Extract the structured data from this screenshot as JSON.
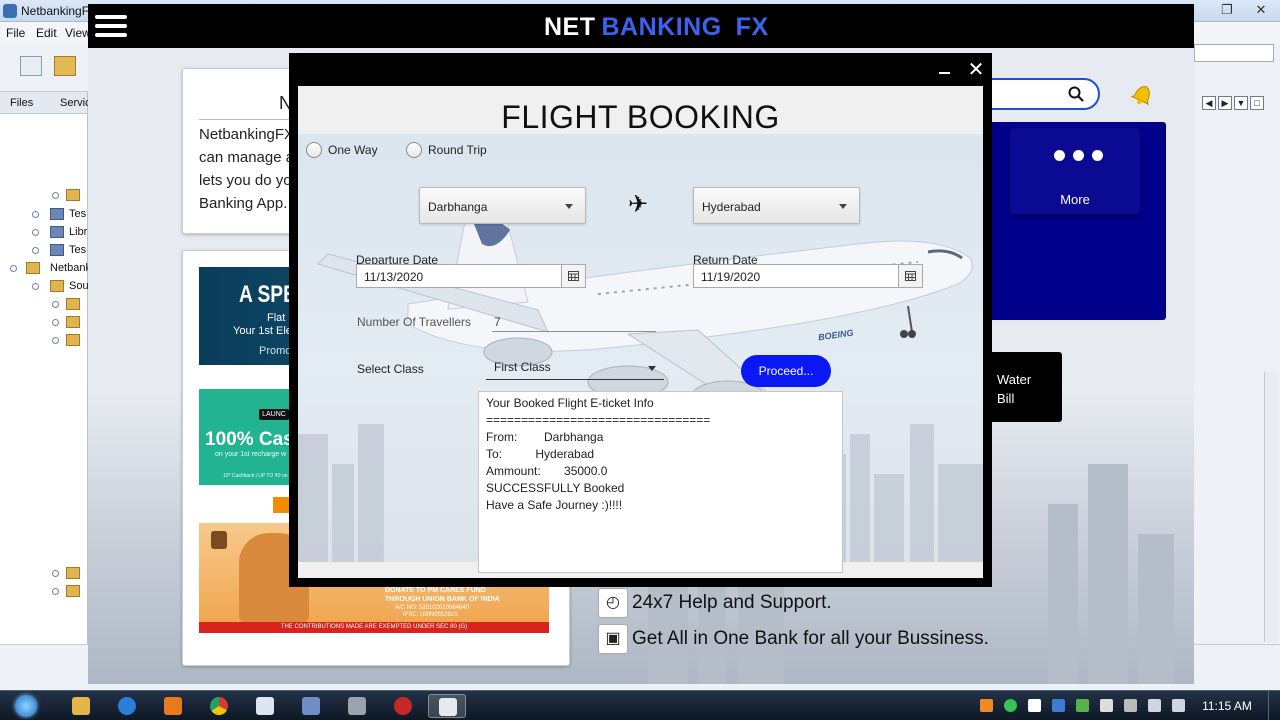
{
  "ide": {
    "window_title": "NetbankingF",
    "menu": [
      "File",
      "Edit",
      "View"
    ],
    "panel_tabs": [
      "Files",
      "Servic"
    ],
    "tree": [
      {
        "label": ""
      },
      {
        "label": "Tes"
      },
      {
        "label": "Libr"
      },
      {
        "label": "Tes"
      },
      {
        "label": "Netbank"
      },
      {
        "label": "Sou"
      },
      {
        "label": ""
      },
      {
        "label": ""
      },
      {
        "label": ""
      },
      {
        "label": ""
      },
      {
        "label": ""
      }
    ]
  },
  "app": {
    "logo_net": "NET",
    "logo_banking": "BANKING",
    "logo_fx": "FX",
    "about": {
      "heading": "N",
      "text_lines": [
        "NetbankingFX",
        "can manage a",
        "lets you do yo",
        "Banking App."
      ]
    },
    "promo1": {
      "big": "A SPE",
      "line1": "Flat ₹",
      "line2": "Your 1st Ele",
      "line3": "Promo"
    },
    "promo2": {
      "tag": "LAUNC",
      "big": "100% Cas",
      "line1": "on your 1st recharge w",
      "line2": "10* Cashback | UP TO ₹0 on"
    },
    "promo3": {
      "line1": "DONATE TO PM CARES FUND",
      "line2": "THROUGH UNION BANK OF INDIA",
      "line3": "A/C NO: 520102010064640",
      "line4": "IFSC: UBIN0552615",
      "bar": "THE CONTRIBUTIONS MADE ARE EXEMPTED UNDER SEC 80 (G)"
    },
    "more_label": "More",
    "water_bill": [
      "Water",
      "Bill"
    ],
    "features": [
      {
        "icon": "help-clock-icon",
        "text": "24x7 Help and Support."
      },
      {
        "icon": "wallet-icon",
        "text": "Get All in One Bank for all your Bussiness."
      }
    ]
  },
  "dialog": {
    "title": "FLIGHT BOOKING",
    "trip_types": [
      "One Way",
      "Round Trip"
    ],
    "from": "Darbhanga",
    "to": "Hyderabad",
    "departure_label": "Departure Date",
    "departure_value": "11/13/2020",
    "return_label": "Return Date",
    "return_value": "11/19/2020",
    "travellers_label": "Number Of Travellers",
    "travellers_value": "7",
    "class_label": "Select Class",
    "class_value": "First Class",
    "proceed_label": "Proceed...",
    "ticket_lines": [
      "Your Booked Flight E-ticket Info",
      "================================",
      "From:        Darbhanga",
      "To:          Hyderabad",
      "Ammount:       35000.0",
      "SUCCESSFULLY Booked",
      "Have a Safe Journey :)!!!!"
    ],
    "plane_brand": "BOEING"
  },
  "taskbar": {
    "clock": "11:15 AM"
  },
  "colors": {
    "accent_blue": "#0a18f5",
    "navy_panel": "#00008b",
    "logo_blue": "#3b63f0"
  }
}
